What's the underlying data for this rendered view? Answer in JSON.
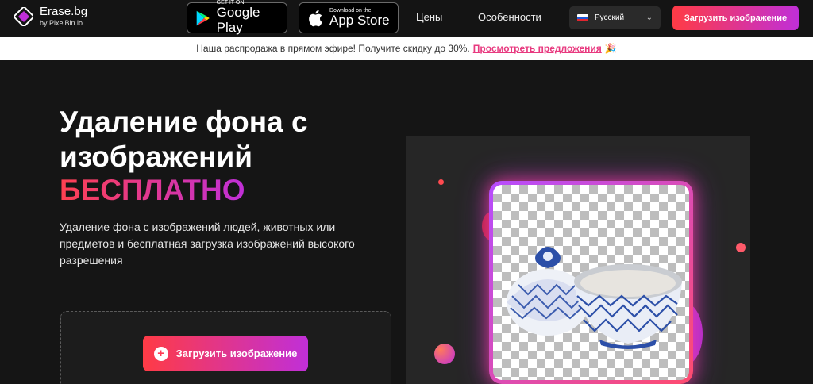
{
  "brand": {
    "title": "Erase.bg",
    "subtitle": "by PixelBin.io",
    "accent": "#c02fd8"
  },
  "header": {
    "google_play": {
      "small": "GET IT ON",
      "big": "Google Play"
    },
    "app_store": {
      "small": "Download on the",
      "big": "App Store"
    },
    "nav": {
      "prices": "Цены",
      "features": "Особенности"
    },
    "language": {
      "label": "Русский"
    },
    "upload_button": "Загрузить изображение"
  },
  "promo": {
    "text": "Наша распродажа в прямом эфире! Получите скидку до 30%.",
    "link": "Просмотреть предложения",
    "icon": "party-popper-icon"
  },
  "hero": {
    "title": "Удаление фона с изображений",
    "accent": "БЕСПЛАТНО",
    "description": "Удаление фона с изображений людей, животных или предметов и бесплатная загрузка изображений высокого разрешения",
    "upload_button": "Загрузить изображение"
  },
  "colors": {
    "gradient_start": "#ff3b45",
    "gradient_end": "#c02fd8",
    "promo_link": "#e8397f"
  }
}
